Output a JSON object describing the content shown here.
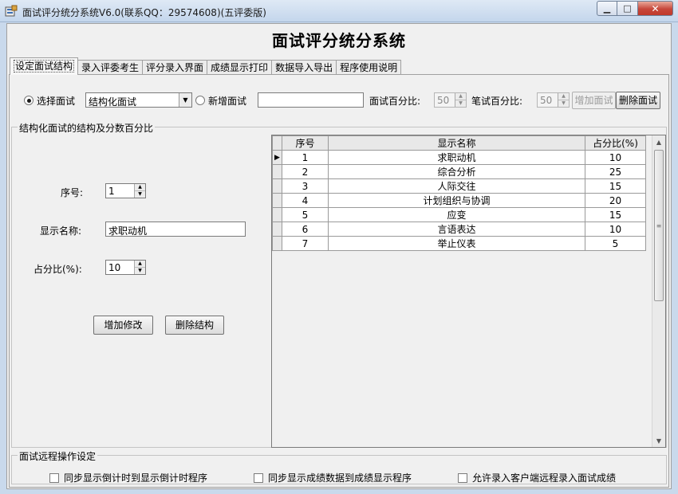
{
  "window": {
    "title": "面试评分统分系统V6.0(联系QQ：29574608)(五评委版)"
  },
  "app": {
    "title": "面试评分统分系统"
  },
  "tabs": [
    "设定面试结构",
    "录入评委考生",
    "评分录入界面",
    "成绩显示打印",
    "数据导入导出",
    "程序使用说明"
  ],
  "controls": {
    "select_label": "选择面试",
    "select_value": "结构化面试",
    "new_label": "新增面试",
    "new_value": "",
    "interview_pct_label": "面试百分比:",
    "interview_pct": "50",
    "written_pct_label": "笔试百分比:",
    "written_pct": "50",
    "add_btn": "增加面试",
    "del_btn": "删除面试"
  },
  "group": {
    "title": "结构化面试的结构及分数百分比",
    "seq_label": "序号:",
    "seq_value": "1",
    "name_label": "显示名称:",
    "name_value": "求职动机",
    "pct_label": "占分比(%):",
    "pct_value": "10",
    "save_btn": "增加修改",
    "delete_btn": "删除结构"
  },
  "grid": {
    "headers": [
      "序号",
      "显示名称",
      "占分比(%)"
    ],
    "rows": [
      [
        "1",
        "求职动机",
        "10"
      ],
      [
        "2",
        "综合分析",
        "25"
      ],
      [
        "3",
        "人际交往",
        "15"
      ],
      [
        "4",
        "计划组织与协调",
        "20"
      ],
      [
        "5",
        "应变",
        "15"
      ],
      [
        "6",
        "言语表达",
        "10"
      ],
      [
        "7",
        "举止仪表",
        "5"
      ]
    ]
  },
  "remote": {
    "title": "面试远程操作设定",
    "options": [
      "同步显示倒计时到显示倒计时程序",
      "同步显示成绩数据到成绩显示程序",
      "允许录入客户端远程录入面试成绩"
    ]
  },
  "colors": {
    "title_bar": "#c9d9ec",
    "close_button": "#c7473a",
    "panel": "#f0f0f0"
  }
}
